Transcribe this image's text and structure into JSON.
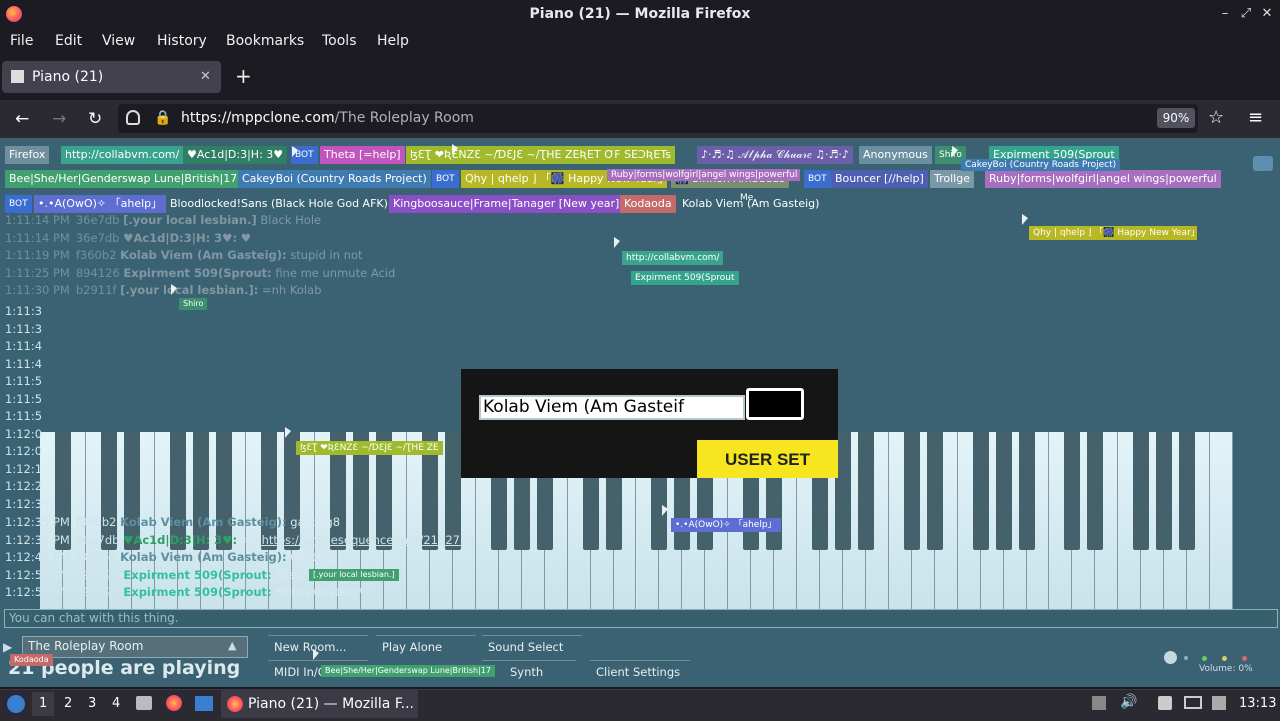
{
  "window": {
    "title": "Piano (21) — Mozilla Firefox"
  },
  "menu": [
    "File",
    "Edit",
    "View",
    "History",
    "Bookmarks",
    "Tools",
    "Help"
  ],
  "tab": {
    "label": "Piano (21)",
    "new_tab": "+"
  },
  "nav": {
    "url_host": "https://mppclone.com",
    "url_path": "/The Roleplay Room",
    "zoom": "90%"
  },
  "users": [
    {
      "label": "Firefox",
      "color": "#6f8f9c"
    },
    {
      "label": "http://collabvm.com/",
      "color": "#3aa38e"
    },
    {
      "label": "♥Ac1d|D:3|H: 3♥",
      "color": "#2f7f62"
    },
    {
      "label": "BOT",
      "color": "#3b6dd1"
    },
    {
      "label": "Theta [=help]",
      "color": "#c353bd"
    },
    {
      "label": "ɮƐƮ ❤ƦƐNZƐ ~/ƊƐJƐ ~/ƮHE ZEƦET ƠF SEƆƦETs",
      "color": "#9fbb2d"
    },
    {
      "label": "♪·♬·♫ 𝒜𝓁𝓅𝒽𝒶 𝒞𝒽𝓊𝒶𝓇𝑒 ♫·♬·♪",
      "color": "#6a5fa8"
    },
    {
      "label": "Anonymous",
      "color": "#6a8fa0"
    },
    {
      "label": "Shiro",
      "color": "#3b8f6f"
    },
    {
      "label": "Expirment 509(Sprout",
      "color": "#34a58c"
    },
    {
      "label": "Bee|She/Her|Genderswap Lune|British|17",
      "color": "#40a070"
    },
    {
      "label": "CakeyBoi (Country Roads Project)",
      "color": "#3f7bb0"
    },
    {
      "label": "BOT",
      "color": "#3b6dd1"
    },
    {
      "label": "Qhy | qhelp ⌋ 「🎆 Happy New Year」",
      "color": "#b8b825"
    },
    {
      "label": "🎆 Sinnoh Amadeus",
      "color": "#7b8f6f"
    },
    {
      "label": "BOT",
      "color": "#3b6dd1"
    },
    {
      "label": "Bouncer [//help]",
      "color": "#4d5fb0"
    },
    {
      "label": "Trollge",
      "color": "#7b98a6"
    },
    {
      "label": "Ruby|forms|wolfgirl|angel wings|powerful",
      "color": "#a86ec0"
    },
    {
      "label": "BOT",
      "color": "#3b6dd1"
    },
    {
      "label": "•.•A(OwO)✧ 「ahelp」",
      "color": "#5d6dd2"
    },
    {
      "label": "Bloodlocked!Sans (Black Hole God AFK)",
      "color": "#3b6272"
    },
    {
      "label": "Kingboosauce|Frame|Tanager [New year]",
      "color": "#8a4fc7"
    },
    {
      "label": "Kodaoda",
      "color": "#c46a6a"
    },
    {
      "label": "Kolab Viem (Am Gasteig)",
      "color": "#3b6272"
    }
  ],
  "chat_top": [
    {
      "time": "1:11:14 PM",
      "id": "36e7db",
      "name": "[.your local lesbian.]",
      "msg": "Black Hole"
    },
    {
      "time": "1:11:14 PM",
      "id": "36e7db",
      "name": "♥Ac1d|D:3|H: 3♥:",
      "msg": "♥"
    },
    {
      "time": "1:11:19 PM",
      "id": "f360b2",
      "name": "Kolab Viem (Am Gasteig):",
      "msg": "stupid in not"
    },
    {
      "time": "1:11:25 PM",
      "id": "894126",
      "name": "Expirment 509(Sprout:",
      "msg": "fine me unmute Acid"
    },
    {
      "time": "1:11:30 PM",
      "id": "b2911f",
      "name": "[.your local lesbian.]:",
      "msg": "=nh Kolab"
    }
  ],
  "chat_side_times": [
    "1:11:3",
    "1:11:3",
    "1:11:4",
    "1:11:4",
    "1:11:5",
    "1:11:5",
    "1:11:5",
    "1:12:0",
    "1:12:0",
    "1:12:1",
    "1:12:2",
    "1:12:3"
  ],
  "chat_bottom": [
    {
      "time": "1:12:35 PM",
      "id": "f360b2",
      "name": "Kolab Viem (Am Gasteig):",
      "msg": "gasteig8",
      "color": "#5f8fa0"
    },
    {
      "time": "1:12:38 PM",
      "id": "36e7db",
      "name": "♥Ac1d|D:3|H: 3♥:",
      "msg": "> :",
      "link": "https://onlinesequencer.net/2152730",
      "color": "#2f9f62"
    },
    {
      "time": "1:12:43 PM",
      "id": "f360b2",
      "name": "Kolab Viem (Am Gasteig):",
      "msg": "Gasteig",
      "color": "#5f8fa0"
    },
    {
      "time": "1:12:50 PM",
      "id": "894126",
      "name": "Expirment 509(Sprout:",
      "msg": "*ites",
      "color": "#34c0a0"
    },
    {
      "time": "1:12:55 PM",
      "id": "894126",
      "name": "Expirment 509(Sprout:",
      "msg": "*Bites Gasteig*",
      "color": "#34c0a0"
    }
  ],
  "floating_labels": [
    {
      "label": "Me",
      "color": "#3b6272"
    },
    {
      "label": "CakeyBoi (Country Roads Project)",
      "color": "#3f7bb0"
    },
    {
      "label": "Ruby|forms|wolfgirl|angel wings|powerful",
      "color": "#a86ec0"
    },
    {
      "label": "Qhy | qhelp ⌋ 「🎆 Happy New Year」",
      "color": "#b8b825"
    },
    {
      "label": "http://collabvm.com/",
      "color": "#3aa38e"
    },
    {
      "label": "Expirment 509(Sprout",
      "color": "#34a58c"
    },
    {
      "label": "Shiro",
      "color": "#3b8f6f"
    },
    {
      "label": "ɮƐƮ ❤ƦƐNZƐ ~/ƊƐJƐ ~/ƮHE ZE",
      "color": "#9fbb2d"
    },
    {
      "label": "•.•A(OwO)✧ 「ahelp」",
      "color": "#5d6dd2"
    },
    {
      "label": "[.your local lesbian.]",
      "color": "#40a070"
    },
    {
      "label": "Kodaoda",
      "color": "#c46a6a"
    },
    {
      "label": "Bee|She/Her|Genderswap Lune|British|17",
      "color": "#40a070"
    }
  ],
  "modal": {
    "name_value": "Kolab Viem (Am Gasteif",
    "user_set": "USER SET"
  },
  "chat_input_placeholder": "You can chat with this thing.",
  "controls": {
    "room": "The Roleplay Room",
    "players_text": "21 people are playing",
    "new_room": "New Room...",
    "play_alone": "Play Alone",
    "sound_select": "Sound Select",
    "midi": "MIDI In/Out",
    "synth": "Synth",
    "client_settings": "Client Settings",
    "volume": "Volume: 0%"
  },
  "taskbar": {
    "workspaces": [
      "1",
      "2",
      "3",
      "4"
    ],
    "app": "Piano (21) — Mozilla F...",
    "clock": "13:13"
  }
}
